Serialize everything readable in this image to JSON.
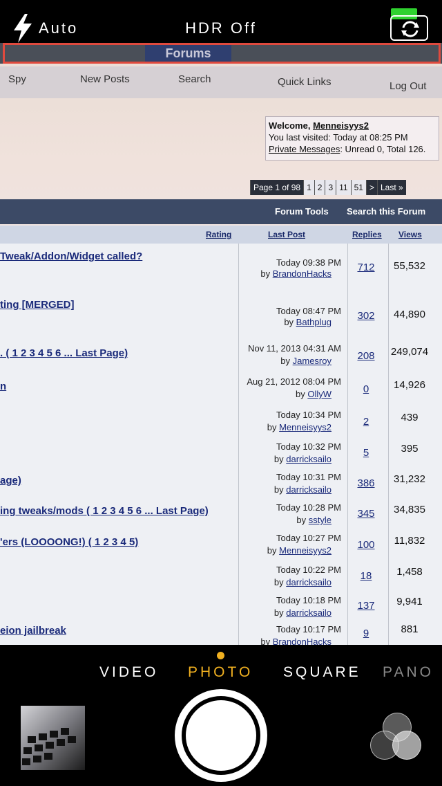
{
  "camera": {
    "flash_label": "Auto",
    "hdr_label": "HDR Off",
    "modes": [
      "VIDEO",
      "PHOTO",
      "SQUARE",
      "PANO"
    ],
    "selected_mode": "PHOTO",
    "accent_color": "#f0b020"
  },
  "screen": {
    "header_tab": "Forums",
    "nav": [
      "Spy",
      "New Posts",
      "Search",
      "Quick Links",
      "Log Out"
    ],
    "welcome": {
      "line1_prefix": "Welcome, ",
      "username": "Menneisyys2",
      "line2": "You last visited: Today at 08:25 PM",
      "pm_link": "Private Messages",
      "pm_rest": ": Unread 0, Total 126."
    },
    "pager": [
      "Page 1 of 98",
      "1",
      "2",
      "3",
      "11",
      "51",
      ">",
      "Last »"
    ],
    "tools": [
      "Forum Tools",
      "Search this Forum"
    ],
    "columns": [
      "Rating",
      "Last Post",
      "Replies",
      "Views"
    ],
    "rows": [
      {
        "title": "Tweak/Addon/Widget called?",
        "date": "Today 09:38 PM",
        "by": "by ",
        "user": "BrandonHacks",
        "replies": "712",
        "views": "55,532"
      },
      {
        "title": "ting [MERGED]",
        "date": "Today 08:47 PM",
        "by": "by ",
        "user": "Bathplug",
        "replies": "302",
        "views": "44,890"
      },
      {
        "title": ". ( 1 2 3 4 5 6 ... Last Page)",
        "date": "Nov 11, 2013 04:31 AM",
        "by": "by ",
        "user": "Jamesroy",
        "replies": "208",
        "views": "249,074"
      },
      {
        "title": "n",
        "date": "Aug 21, 2012 08:04 PM",
        "by": "by ",
        "user": "OllyW",
        "replies": "0",
        "views": "14,926"
      },
      {
        "title": "",
        "date": "Today 10:34 PM",
        "by": "by ",
        "user": "Menneisyys2",
        "replies": "2",
        "views": "439"
      },
      {
        "title": "",
        "date": "Today 10:32 PM",
        "by": "by ",
        "user": "darricksailo",
        "replies": "5",
        "views": "395"
      },
      {
        "title": "age)",
        "date": "Today 10:31 PM",
        "by": "by ",
        "user": "darricksailo",
        "replies": "386",
        "views": "31,232"
      },
      {
        "title": "ing tweaks/mods ( 1 2 3 4 5 6 ... Last Page)",
        "date": "Today 10:28 PM",
        "by": "by ",
        "user": "sstyle",
        "replies": "345",
        "views": "34,835"
      },
      {
        "title": "'ers (LOOOONG!) ( 1 2 3 4 5)",
        "date": "Today 10:27 PM",
        "by": "by ",
        "user": "Menneisyys2",
        "replies": "100",
        "views": "11,832"
      },
      {
        "title": "",
        "date": "Today 10:22 PM",
        "by": "by ",
        "user": "darricksailo",
        "replies": "18",
        "views": "1,458"
      },
      {
        "title": "",
        "date": "Today 10:18 PM",
        "by": "by ",
        "user": "darricksailo",
        "replies": "137",
        "views": "9,941"
      },
      {
        "title": "eion jailbreak",
        "date": "Today 10:17 PM",
        "by": "by ",
        "user": "BrandonHacks",
        "replies": "9",
        "views": "881"
      }
    ]
  }
}
